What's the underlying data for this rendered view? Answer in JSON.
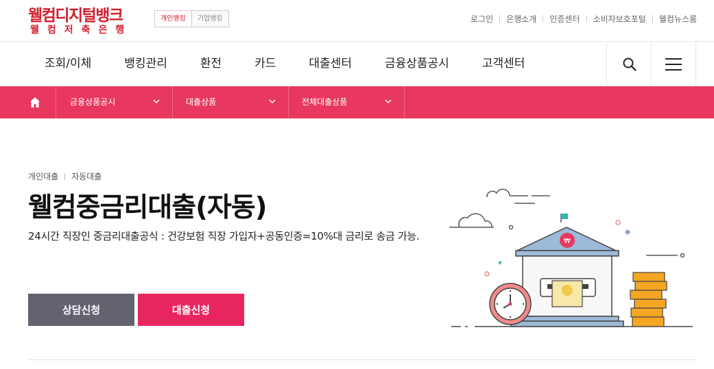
{
  "brand": {
    "name_line1": "웰컴디지털뱅크",
    "name_line2": "웰컴저축은행",
    "color": "#d51d2b"
  },
  "bank_tabs": [
    {
      "label": "개인뱅킹",
      "active": true
    },
    {
      "label": "기업뱅킹",
      "active": false
    }
  ],
  "util_links": [
    "로그인",
    "은행소개",
    "인증센터",
    "소비자보호포털",
    "웰컴뉴스룸"
  ],
  "main_nav": [
    "조회/이체",
    "뱅킹관리",
    "환전",
    "카드",
    "대출센터",
    "금융상품공시",
    "고객센터"
  ],
  "nav_buttons": {
    "search_icon": "search-icon",
    "menu_icon": "hamburger-icon"
  },
  "breadcrumb": {
    "home_icon": "home-icon",
    "selects": [
      "금융상품공시",
      "대출상품",
      "전체대출상품"
    ],
    "bar_color": "#e8385f"
  },
  "hero": {
    "category": [
      "개인대출",
      "자동대출"
    ],
    "title": "웰컴중금리대출(자동)",
    "description": "24시간 직장인 중금리대출공식 : 건강보험 직장 가입자+공동인증=10%대 금리로 송금 가능.",
    "consult_label": "상담신청",
    "apply_label": "대출신청",
    "consult_color": "#636370",
    "apply_color": "#e8255f"
  }
}
